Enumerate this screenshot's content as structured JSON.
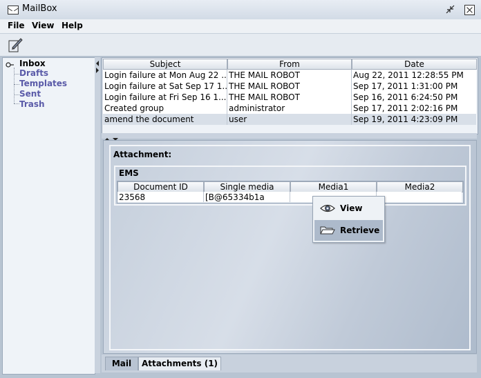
{
  "window": {
    "title": "MailBox"
  },
  "menu": {
    "file": "File",
    "view": "View",
    "help": "Help"
  },
  "tree": {
    "inbox": "Inbox",
    "drafts": "Drafts",
    "templates": "Templates",
    "sent": "Sent",
    "trash": "Trash"
  },
  "mail_table": {
    "columns": [
      "Subject",
      "From",
      "Date"
    ],
    "rows": [
      {
        "subject": "Login failure at Mon Aug 22 ...",
        "from": "THE MAIL ROBOT",
        "date": "Aug 22, 2011 12:28:55 PM"
      },
      {
        "subject": "Login failure at Sat Sep 17 1...",
        "from": "THE MAIL ROBOT",
        "date": "Sep 17, 2011 1:31:00 PM"
      },
      {
        "subject": "Login failure at Fri Sep 16 1...",
        "from": "THE MAIL ROBOT",
        "date": "Sep 16, 2011 6:24:50 PM"
      },
      {
        "subject": "Created group",
        "from": "administrator",
        "date": "Sep 17, 2011 2:02:16 PM"
      },
      {
        "subject": "amend the document",
        "from": "user",
        "date": "Sep 19, 2011 4:23:09 PM"
      }
    ]
  },
  "attachment": {
    "label": "Attachment:",
    "ems_label": "EMS",
    "columns": [
      "Document ID",
      "Single media",
      "Media1",
      "Media2"
    ],
    "row": {
      "document_id": "23568",
      "single_media": "[B@65334b1a",
      "media1": "",
      "media2": ""
    }
  },
  "context_menu": {
    "view": "View",
    "retrieve": "Retrieve"
  },
  "tabs": {
    "mail": "Mail",
    "attachments": "Attachments (1)"
  },
  "colors": {
    "tree_link": "#5a5aa8",
    "selection": "#d8dfe8",
    "menu_highlight": "#adbacb"
  }
}
